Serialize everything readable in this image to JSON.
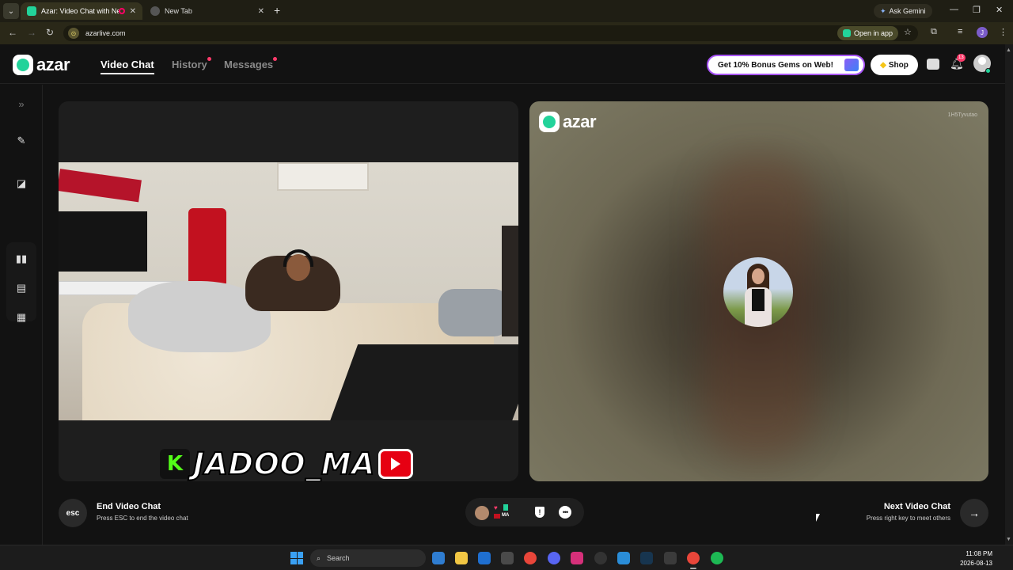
{
  "browser": {
    "tabs": [
      {
        "title": "Azar: Video Chat with New",
        "active": true
      },
      {
        "title": "New Tab",
        "active": false
      }
    ],
    "new_tab": "+",
    "ask_gemini": "Ask Gemini",
    "url": "azarlive.com",
    "open_in_app": "Open in app",
    "profile_initial": "J"
  },
  "azar": {
    "logo_text": "azar",
    "nav": {
      "video_chat": "Video Chat",
      "history": "History",
      "messages": "Messages"
    },
    "gems_promo": "Get 10% Bonus Gems on Web!",
    "shop": "Shop",
    "notification_count": "13",
    "remote": {
      "logo_text": "azar",
      "user_id": "1H5Tyvutao"
    },
    "streamer_overlay": {
      "kick_letter": "K",
      "name": "JADOO_MA"
    },
    "controls": {
      "esc_label": "esc",
      "end_title": "End Video Chat",
      "end_sub": "Press ESC to end the video chat",
      "mini_label": "MA",
      "next_title": "Next Video Chat",
      "next_sub": "Press right key to meet others",
      "next_arrow": "→"
    }
  },
  "taskbar": {
    "search_placeholder": "Search",
    "time": "11:08 PM",
    "date": "2026-08-13"
  },
  "colors": {
    "brand_green": "#22d39a",
    "notification_red": "#ff3b6b",
    "gems_border": "#a855f7"
  }
}
